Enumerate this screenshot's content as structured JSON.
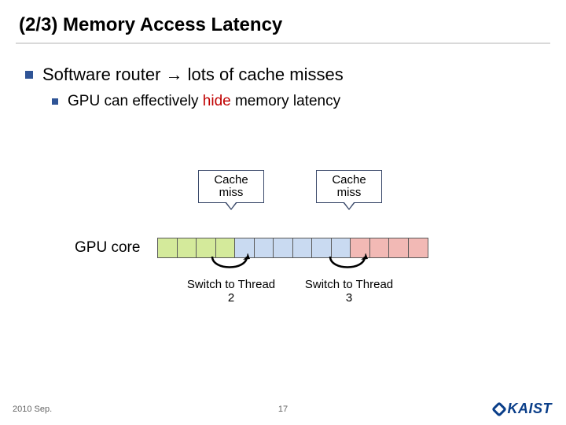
{
  "title": "(2/3) Memory Access Latency",
  "bullets": {
    "l1": "Software router → lots of cache misses",
    "l2_pre": "GPU can effectively ",
    "l2_em": "hide",
    "l2_post": " memory latency"
  },
  "diagram": {
    "gpu_label": "GPU core",
    "callout1": "Cache miss",
    "callout2": "Cache miss",
    "switch1": "Switch to Thread 2",
    "switch2": "Switch to Thread 3",
    "cells": [
      "g",
      "g",
      "g",
      "g",
      "b",
      "b",
      "b",
      "b",
      "b",
      "b",
      "r",
      "r",
      "r",
      "r"
    ]
  },
  "footer": {
    "date": "2010 Sep.",
    "page": "17",
    "logo": "KAIST"
  },
  "colors": {
    "accent": "#2f5496",
    "emph": "#c00000",
    "green": "#d4ea9b",
    "blue": "#c9daf1",
    "red": "#f2b9b5"
  }
}
